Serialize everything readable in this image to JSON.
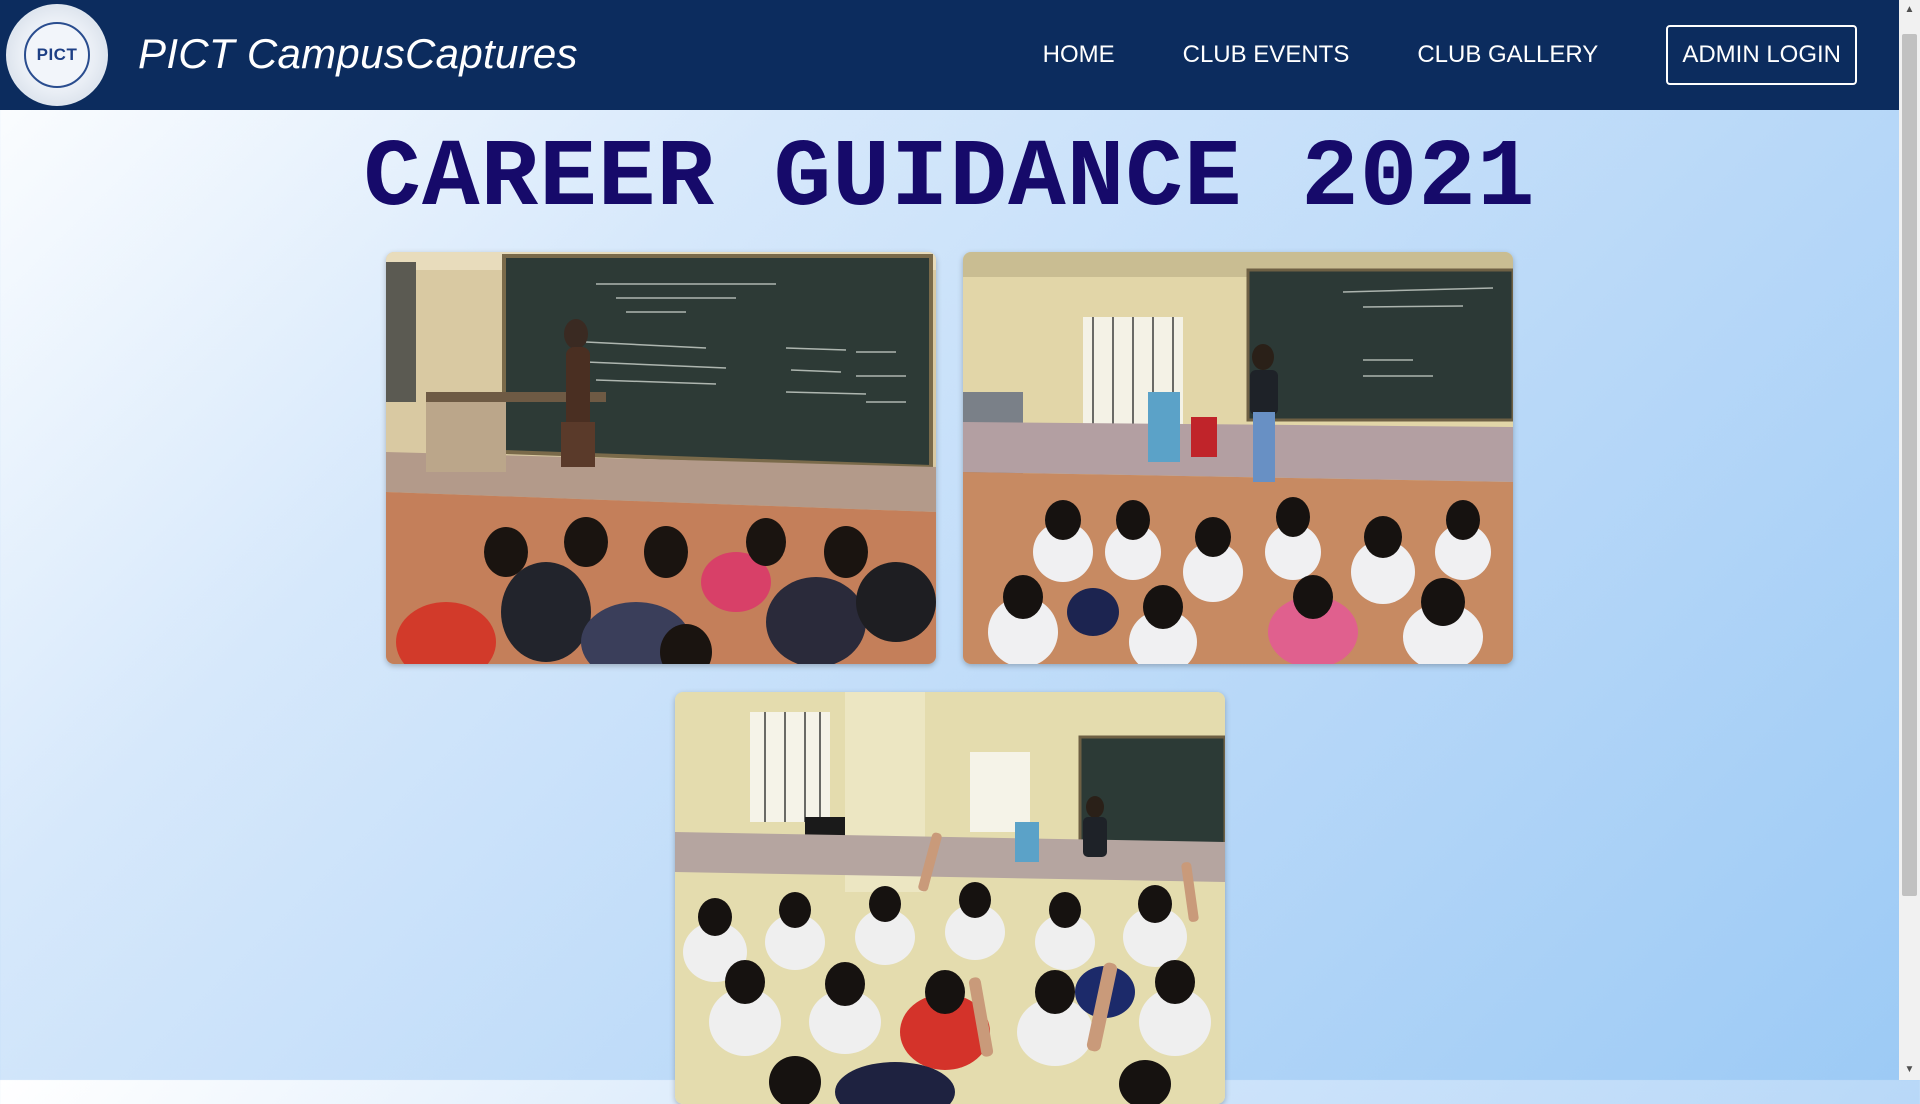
{
  "nav": {
    "logo_text": "PICT",
    "brand": "PICT CampusCaptures",
    "links": [
      {
        "label": "HOME"
      },
      {
        "label": "CLUB EVENTS"
      },
      {
        "label": "CLUB GALLERY"
      }
    ],
    "admin_label": "ADMIN LOGIN"
  },
  "main": {
    "title": "CAREER GUIDANCE 2021"
  },
  "colors": {
    "navbar": "#0c2c5e",
    "title": "#160a6a",
    "background_end": "#9ccaf5"
  }
}
